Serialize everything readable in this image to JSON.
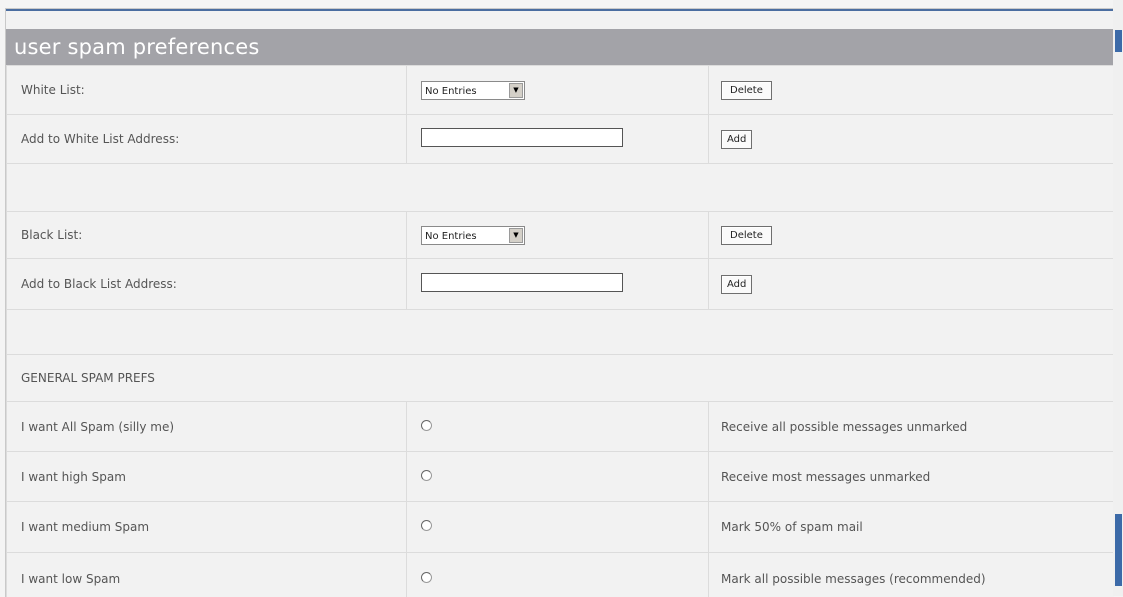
{
  "panel": {
    "title": "user spam preferences"
  },
  "white_list": {
    "label": "White List:",
    "select_value": "No Entries",
    "delete_label": "Delete",
    "add_label": "Add to White List Address:",
    "add_button": "Add",
    "input_value": ""
  },
  "black_list": {
    "label": "Black List:",
    "select_value": "No Entries",
    "delete_label": "Delete",
    "add_label": "Add to Black List Address:",
    "add_button": "Add",
    "input_value": ""
  },
  "general": {
    "heading": "GENERAL SPAM PREFS",
    "options": [
      {
        "label": "I want All Spam (silly me)",
        "description": "Receive all possible messages unmarked",
        "selected": false
      },
      {
        "label": "I want high Spam",
        "description": "Receive most messages unmarked",
        "selected": false
      },
      {
        "label": "I want medium Spam",
        "description": "Mark 50% of spam mail",
        "selected": false
      },
      {
        "label": "I want low Spam",
        "description": "Mark all possible messages (recommended)",
        "selected": false
      }
    ]
  },
  "colors": {
    "header_bg": "#a3a3a8",
    "scrollbar_accent": "#3c6aa8",
    "cell_bg": "#f2f2f2"
  },
  "icons": {
    "dropdown": "chevron-down-icon",
    "radio": "radio-button"
  }
}
